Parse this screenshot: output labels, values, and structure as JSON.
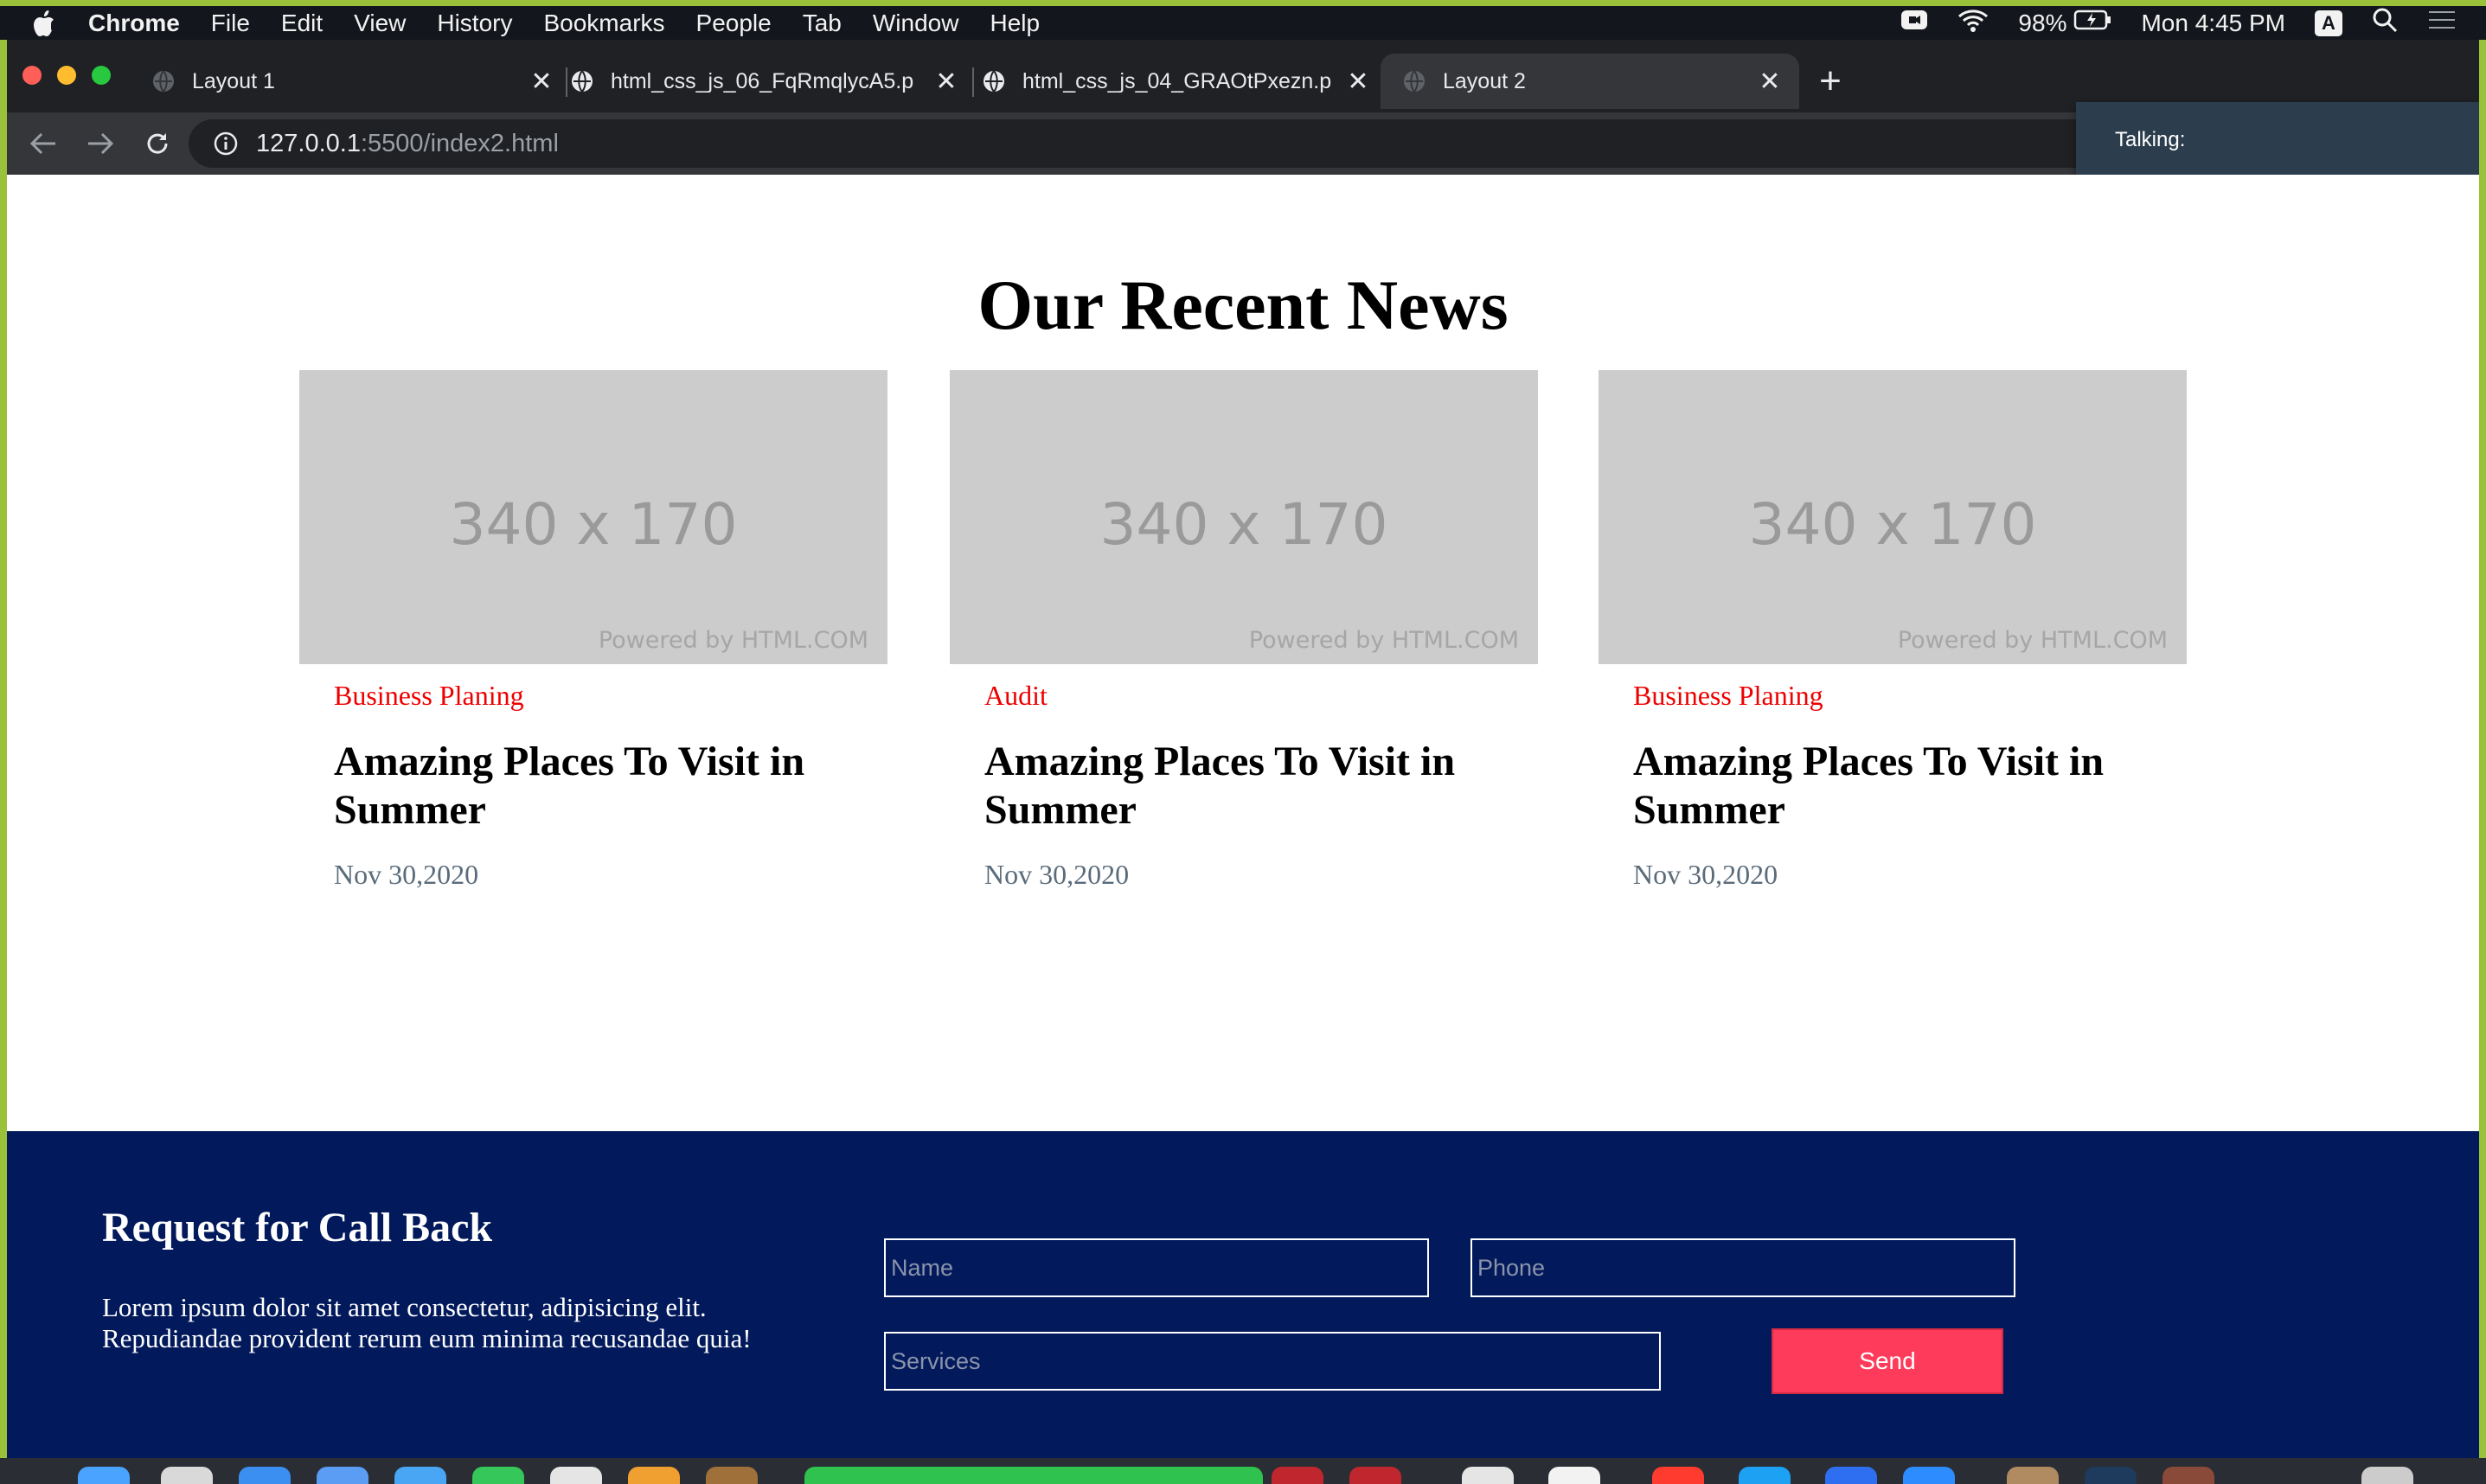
{
  "menubar": {
    "app": "Chrome",
    "items": [
      "File",
      "Edit",
      "View",
      "History",
      "Bookmarks",
      "People",
      "Tab",
      "Window",
      "Help"
    ],
    "battery": "98%",
    "clock": "Mon 4:45 PM",
    "keyboard_badge": "A"
  },
  "tabs": [
    {
      "title": "Layout 1",
      "active": false
    },
    {
      "title": "html_css_js_06_FqRmqlycA5.p",
      "active": false
    },
    {
      "title": "html_css_js_04_GRAOtPxezn.p",
      "active": false
    },
    {
      "title": "Layout 2",
      "active": true
    }
  ],
  "omnibox": {
    "host": "127.0.0.1",
    "path": ":5500/index2.html"
  },
  "talking_panel": "Talking:",
  "news": {
    "title": "Our Recent News",
    "cards": [
      {
        "thumb_label": "340 x 170",
        "powered": "Powered by HTML.COM",
        "category": "Business Planing",
        "headline": "Amazing Places To Visit in Summer",
        "date": "Nov 30,2020"
      },
      {
        "thumb_label": "340 x 170",
        "powered": "Powered by HTML.COM",
        "category": "Audit",
        "headline": "Amazing Places To Visit in Summer",
        "date": "Nov 30,2020"
      },
      {
        "thumb_label": "340 x 170",
        "powered": "Powered by HTML.COM",
        "category": "Business Planing",
        "headline": "Amazing Places To Visit in Summer",
        "date": "Nov 30,2020"
      }
    ]
  },
  "callback": {
    "title": "Request for Call Back",
    "text": "Lorem ipsum dolor sit amet consectetur, adipisicing elit. Repudiandae provident rerum eum minima recusandae quia!",
    "name_placeholder": "Name",
    "phone_placeholder": "Phone",
    "services_placeholder": "Services",
    "send_label": "Send"
  },
  "colors": {
    "accent_red": "#ee0000",
    "footer_bg": "#021a5c",
    "send_button": "#ff3b5c"
  }
}
